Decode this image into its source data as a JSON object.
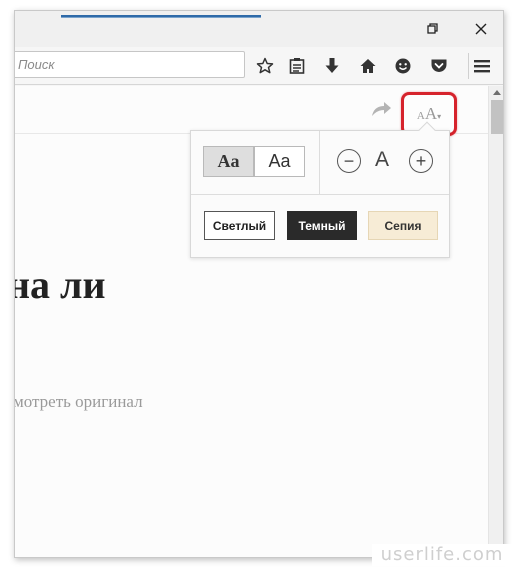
{
  "toolbar": {
    "search_placeholder": "Поиск",
    "icons": [
      "star-icon",
      "reading-list-icon",
      "download-icon",
      "home-icon",
      "smiley-icon",
      "pocket-icon",
      "menu-icon"
    ]
  },
  "window": {
    "controls": [
      "maximize-icon",
      "close-icon"
    ]
  },
  "reader": {
    "aa_small": "A",
    "aa_large": "A",
    "aa_caret": "▾",
    "title_fragment": "на ли",
    "original_link": "мотреть оригинал"
  },
  "popup": {
    "font_serif_label": "Aa",
    "font_sans_label": "Aa",
    "decrease_label": "−",
    "size_label": "A",
    "increase_label": "+",
    "themes": {
      "light": "Светлый",
      "dark": "Темный",
      "sepia": "Сепия"
    }
  },
  "colors": {
    "highlight": "#d6232c",
    "dark_theme": "#2a2a2a",
    "sepia_theme": "#f7ecd6"
  },
  "watermark": "userlife.com"
}
